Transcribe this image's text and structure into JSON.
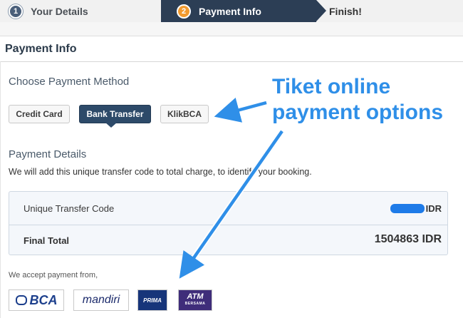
{
  "stepper": {
    "steps": [
      {
        "number": "1",
        "label": "Your Details"
      },
      {
        "number": "2",
        "label": "Payment Info"
      },
      {
        "number": "",
        "label": "Finish!"
      }
    ]
  },
  "page": {
    "title": "Payment Info"
  },
  "payment_method": {
    "heading": "Choose Payment Method",
    "options": [
      "Credit Card",
      "Bank Transfer",
      "KlikBCA"
    ],
    "selected": "Bank Transfer"
  },
  "annotation": {
    "line1": "Tiket online",
    "line2": "payment options",
    "color": "#2f8fe8"
  },
  "payment_details": {
    "heading": "Payment Details",
    "description": "We will add this unique transfer code to total charge, to identify your booking.",
    "unique_transfer_code_label": "Unique Transfer Code",
    "unique_transfer_code_currency": "IDR",
    "final_total_label": "Final Total",
    "final_total_value": "1504863 IDR"
  },
  "accepted": {
    "label": "We accept payment from,",
    "logos": [
      "BCA",
      "mandiri",
      "PRIMA",
      "ATM",
      "BERSAMA"
    ]
  },
  "colors": {
    "active_step": "#2c3e55",
    "step_badge": "#f29a2e",
    "selected_button": "#2d4a69",
    "redaction": "#1e7be8"
  }
}
